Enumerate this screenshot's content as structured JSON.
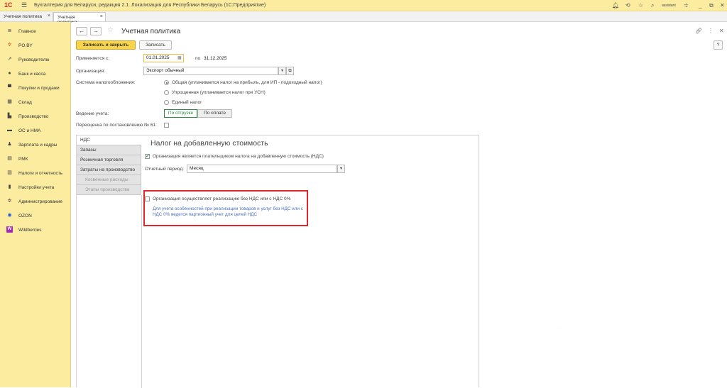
{
  "app": {
    "logo": "1С",
    "menu_glyph": "☰",
    "title": "Бухгалтерия для Беларуси, редакция 2.1. Локализация для Республики Беларусь   (1С:Предприятие)",
    "user": "assistant"
  },
  "tabs": [
    {
      "label": "Учетная политика",
      "close": "×"
    },
    {
      "label": "Учетная политика",
      "close": "×"
    }
  ],
  "sidebar": {
    "items": [
      {
        "label": "Главное",
        "icon": "≣"
      },
      {
        "label": "PO.BY",
        "icon": "✲"
      },
      {
        "label": "Руководителю",
        "icon": "↗"
      },
      {
        "label": "Банк и касса",
        "icon": "●"
      },
      {
        "label": "Покупки и продажи",
        "icon": "▀"
      },
      {
        "label": "Склад",
        "icon": "▦"
      },
      {
        "label": "Производство",
        "icon": "▙"
      },
      {
        "label": "ОС и НМА",
        "icon": "▬"
      },
      {
        "label": "Зарплата и кадры",
        "icon": "♟"
      },
      {
        "label": "РМК",
        "icon": "▤"
      },
      {
        "label": "Налоги и отчетность",
        "icon": "▥"
      },
      {
        "label": "Настройки учета",
        "icon": "▮"
      },
      {
        "label": "Администрирование",
        "icon": "✲"
      },
      {
        "label": "OZON",
        "icon": "◉"
      },
      {
        "label": "Wildberries",
        "icon": "W"
      }
    ],
    "colors": {
      "ozon": "#1e5bd8",
      "wildberries": "#a42ab8",
      "po_by": "#e05a1c"
    }
  },
  "form": {
    "back": "←",
    "forward": "→",
    "star": "☆",
    "title": "Учетная политика",
    "help": "?",
    "save_close": "Записать и закрыть",
    "save": "Записать",
    "applies_label": "Применяется с:",
    "date_from": "01.01.2025",
    "to_label": "по",
    "date_to": "31.12.2025",
    "org_label": "Организация:",
    "org_value": "Экспорт обычный",
    "tax_label": "Система налогообложения:",
    "tax_options": [
      "Общая (уплачивается налог на прибыль, для ИП - подоходный налог)",
      "Упрощенная (уплачивается налог при УСН)",
      "Единый налог"
    ],
    "acc_label": "Ведение учета:",
    "acc_options": [
      "По отгрузке",
      "По оплате"
    ],
    "reval_label": "Переоценка по постановлению № 61:"
  },
  "vtabs": [
    "НДС",
    "Запасы",
    "Розничная торговля",
    "Затраты на производство",
    "Косвенные расходы",
    "Этапы производства"
  ],
  "vat": {
    "title": "Налог на добавленную стоимость",
    "payer_label": "Организация является плательщиком налога на добавленную стоимость (НДС)",
    "period_label": "Отчетный период:",
    "period_value": "Месяц",
    "no_vat_label": "Организация осуществляет реализацию без НДС или с НДС 0%",
    "hint": "Для учета особенностей при реализации товаров и услуг без НДС или с НДС 0% ведется партионный учет для целей НДС"
  }
}
